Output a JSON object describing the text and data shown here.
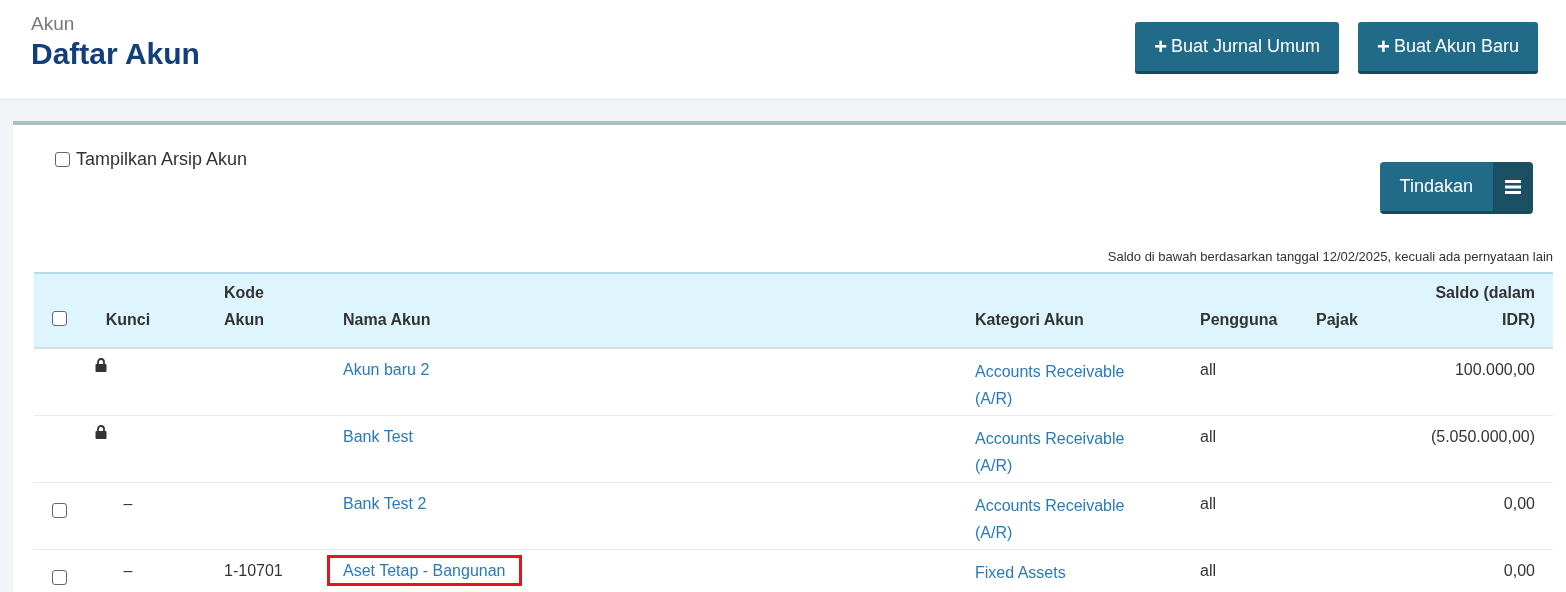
{
  "header": {
    "breadcrumb": "Akun",
    "title": "Daftar Akun",
    "buttons": [
      {
        "icon": "+",
        "label": "Buat Jurnal Umum"
      },
      {
        "icon": "+",
        "label": "Buat Akun Baru"
      }
    ]
  },
  "archive_toggle": {
    "label": "Tampilkan Arsip Akun",
    "checked": false
  },
  "actions_button": {
    "label": "Tindakan"
  },
  "note": "Saldo di bawah berdasarkan tanggal 12/02/2025, kecuali ada pernyataan lain",
  "table": {
    "select_all": {
      "checked": false
    },
    "columns": [
      "Kunci",
      "Kode Akun",
      "Nama Akun",
      "Kategori Akun",
      "Pengguna",
      "Pajak",
      "Saldo (dalam IDR)"
    ],
    "rows": [
      {
        "locked": true,
        "kunci": "",
        "code": "",
        "name": "Akun baru 2",
        "category": "Accounts Receivable (A/R)",
        "user": "all",
        "tax": "",
        "balance": "100.000,00",
        "highlighted": false
      },
      {
        "locked": true,
        "kunci": "",
        "code": "",
        "name": "Bank Test",
        "category": "Accounts Receivable (A/R)",
        "user": "all",
        "tax": "",
        "balance": "(5.050.000,00)",
        "highlighted": false
      },
      {
        "locked": false,
        "checked": false,
        "kunci": "–",
        "code": "",
        "name": "Bank Test 2",
        "category": "Accounts Receivable (A/R)",
        "user": "all",
        "tax": "",
        "balance": "0,00",
        "highlighted": false
      },
      {
        "locked": false,
        "checked": false,
        "kunci": "–",
        "code": "1-10701",
        "name": "Aset Tetap - Bangunan",
        "category": "Fixed Assets",
        "user": "all",
        "tax": "",
        "balance": "0,00",
        "highlighted": true
      }
    ]
  }
}
